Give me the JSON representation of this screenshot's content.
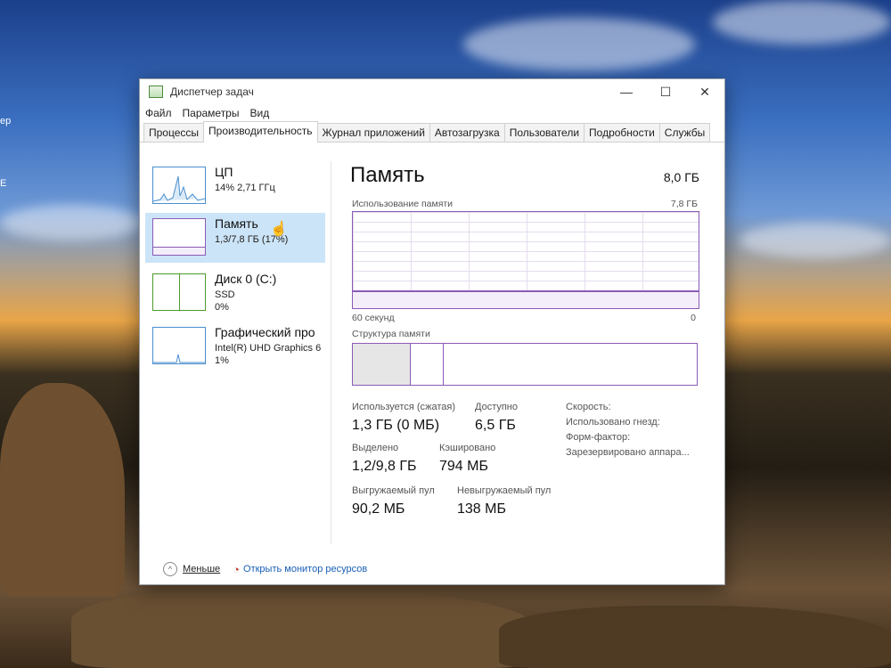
{
  "window": {
    "title": "Диспетчер задач"
  },
  "desktop": {
    "edge_labels": [
      "ер",
      "Е"
    ]
  },
  "menu": [
    "Файл",
    "Параметры",
    "Вид"
  ],
  "tabs": [
    "Процессы",
    "Производительность",
    "Журнал приложений",
    "Автозагрузка",
    "Пользователи",
    "Подробности",
    "Службы"
  ],
  "active_tab": "Производительность",
  "sidebar": {
    "items": [
      {
        "title": "ЦП",
        "line1": "14% 2,71 ГГц",
        "line2": ""
      },
      {
        "title": "Память",
        "line1": "1,3/7,8 ГБ (17%)",
        "line2": ""
      },
      {
        "title": "Диск 0 (C:)",
        "line1": "SSD",
        "line2": "0%"
      },
      {
        "title": "Графический про",
        "line1": "Intel(R) UHD Graphics 6",
        "line2": "1%"
      }
    ],
    "selected": "Память"
  },
  "memory": {
    "title": "Память",
    "total": "8,0 ГБ",
    "usage_label": "Использование памяти",
    "usage_max": "7,8 ГБ",
    "time_left": "60 секунд",
    "time_right": "0",
    "structure_label": "Структура памяти",
    "usage_percent": 17,
    "stats": {
      "in_use_label": "Используется (сжатая)",
      "in_use_value": "1,3 ГБ (0 МБ)",
      "available_label": "Доступно",
      "available_value": "6,5 ГБ",
      "committed_label": "Выделено",
      "committed_value": "1,2/9,8 ГБ",
      "cached_label": "Кэшировано",
      "cached_value": "794 МБ",
      "paged_label": "Выгружаемый пул",
      "paged_value": "90,2 МБ",
      "nonpaged_label": "Невыгружаемый пул",
      "nonpaged_value": "138 МБ"
    },
    "info": {
      "speed": "Скорость:",
      "slots": "Использовано гнезд:",
      "form": "Форм-фактор:",
      "reserved": "Зарезервировано аппара..."
    }
  },
  "footer": {
    "less": "Меньше",
    "monitor": "Открыть монитор ресурсов"
  },
  "colors": {
    "memory_accent": "#8a5bb5",
    "cpu_accent": "#4a8fcf",
    "disk_accent": "#4c9a2a",
    "selected_bg": "#cce4f7",
    "link": "#1a5fb4"
  }
}
